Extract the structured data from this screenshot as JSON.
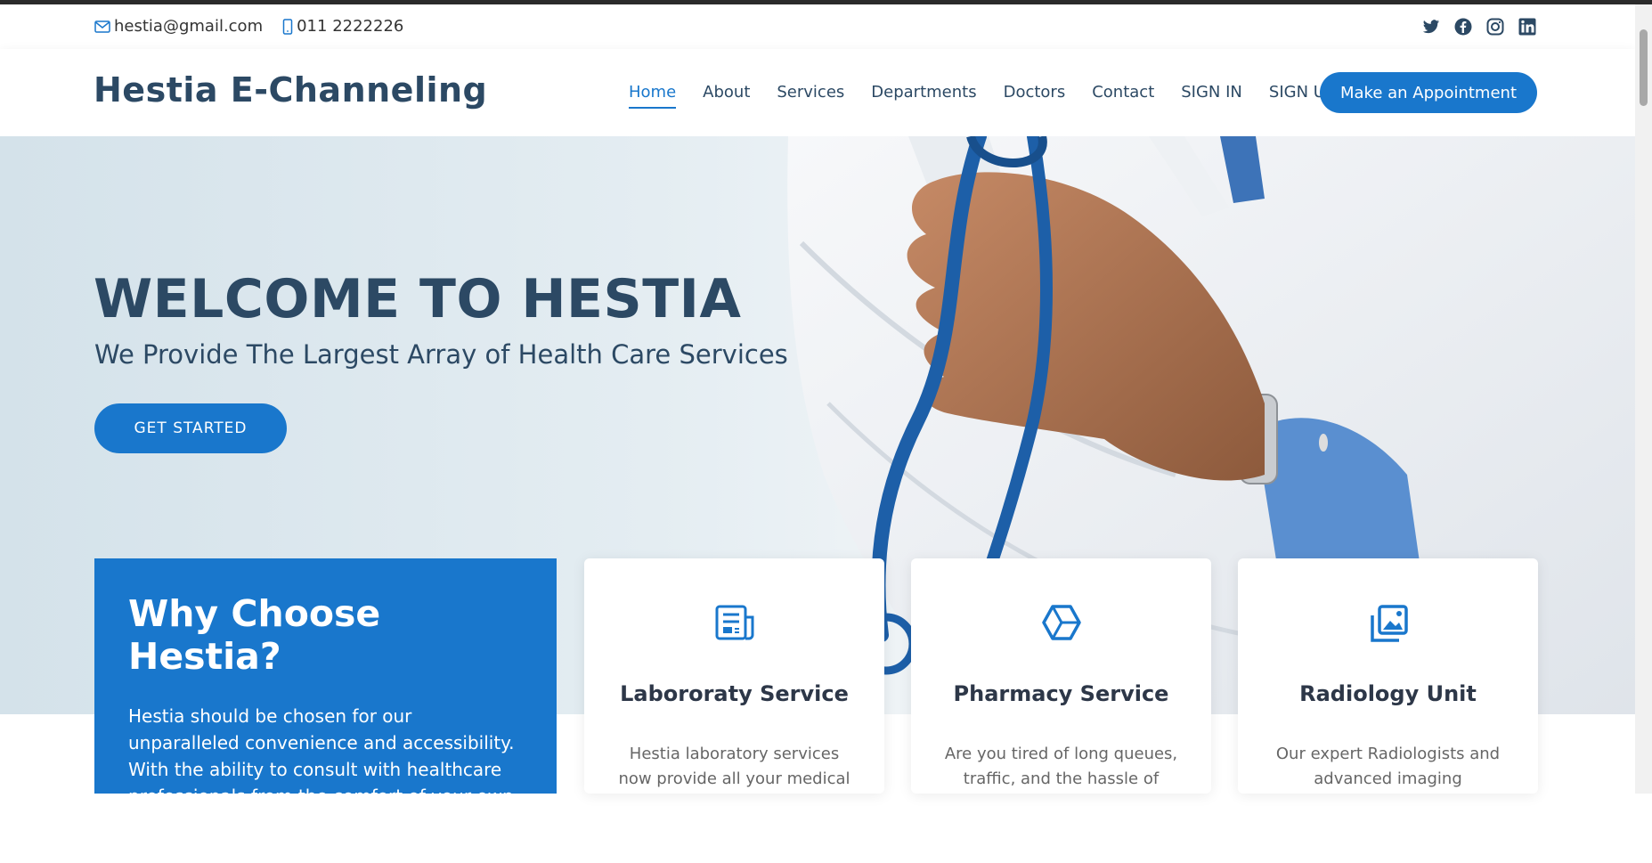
{
  "topbar": {
    "email": "hestia@gmail.com",
    "phone": "011 2222226",
    "email_icon": "envelope-icon",
    "phone_icon": "phone-icon",
    "social": [
      "twitter-icon",
      "facebook-icon",
      "instagram-icon",
      "linkedin-icon"
    ]
  },
  "header": {
    "logo": "Hestia E-Channeling",
    "nav": [
      "Home",
      "About",
      "Services",
      "Departments",
      "Doctors",
      "Contact",
      "SIGN IN",
      "SIGN UP"
    ],
    "active_nav": "Home",
    "appointment_button": "Make an Appointment"
  },
  "hero": {
    "title": "WELCOME TO HESTIA",
    "subtitle": "We Provide The Largest Array of Health Care Services",
    "cta": "GET STARTED"
  },
  "why": {
    "title": "Why Choose Hestia?",
    "text": "Hestia should be chosen for our unparalleled convenience and accessibility. With the ability to consult with healthcare professionals from the comfort of your own space, you can easily schedule appointments that fit your busy"
  },
  "cards": [
    {
      "icon": "document-icon",
      "title": "Laբororaty Service",
      "text": "Hestia laboratory services now provide all your medical"
    },
    {
      "icon": "hexagon-icon",
      "title": "Pharmacy Service",
      "text": "Are you tired of long queues, traffic, and the hassle of"
    },
    {
      "icon": "images-icon",
      "title": "Radiology Unit",
      "text": "Our expert Radiologists and advanced imaging"
    }
  ],
  "colors": {
    "accent": "#1977cc",
    "heading": "#2c4964"
  }
}
